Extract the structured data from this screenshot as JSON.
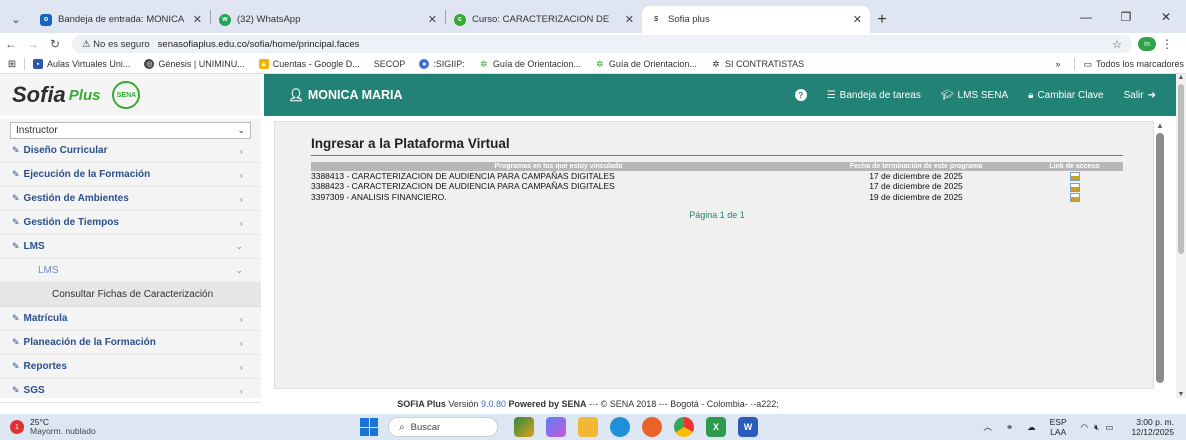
{
  "browser": {
    "tabs": [
      {
        "title": "Bandeja de entrada: MONICA M",
        "icon": "outlook-icon",
        "active": false
      },
      {
        "title": "(32) WhatsApp",
        "icon": "whatsapp-icon",
        "active": false
      },
      {
        "title": "Curso: CARACTERIZACION DE",
        "icon": "moodle-icon",
        "active": false
      },
      {
        "title": "Sofia plus",
        "icon": "sofia-icon",
        "active": true
      }
    ],
    "security_label": "No es seguro",
    "url": "senasofiaplus.edu.co/sofia/home/principal.faces",
    "profile_initial": "m",
    "bookmarks": [
      "Aulas Virtuales Uni...",
      "Génesis | UNIMINU...",
      "Cuentas - Google D...",
      "SECOP",
      ":SIGIIP:",
      "Guía de Orientacion...",
      "Guía de Orientacion...",
      "SI CONTRATISTAS"
    ],
    "bookmarks_overflow": "»",
    "all_bookmarks": "Todos los marcadores"
  },
  "header": {
    "logo_text": "Sofia",
    "logo_plus": "Plus",
    "sena_logo": "SENA",
    "user_name": "MONICA MARIA",
    "links": [
      {
        "label": "Bandeja de tareas",
        "icon": "tray-icon"
      },
      {
        "label": "LMS SENA",
        "icon": "graduation-icon"
      },
      {
        "label": "Cambiar Clave",
        "icon": "lock-icon"
      },
      {
        "label": "Salir",
        "icon": "exit-icon"
      }
    ]
  },
  "sidebar": {
    "role": "Instructor",
    "items": [
      {
        "label": "Diseño Curricular"
      },
      {
        "label": "Ejecución de la Formación"
      },
      {
        "label": "Gestión de Ambientes"
      },
      {
        "label": "Gestión de Tiempos"
      },
      {
        "label": "LMS"
      }
    ],
    "sub_label": "LMS",
    "leaf_label": "Consultar Fichas de Caracterización",
    "items_after": [
      {
        "label": "Matrícula"
      },
      {
        "label": "Planeación de la Formación"
      },
      {
        "label": "Reportes"
      },
      {
        "label": "SGS"
      }
    ]
  },
  "main": {
    "title": "Ingresar a la Plataforma Virtual",
    "columns": [
      "Programas en los que estoy vinculado",
      "Fecha de terminación de este programa",
      "Link de acceso"
    ],
    "rows": [
      {
        "program": "3388413 - CARACTERIZACION DE AUDIENCIA PARA CAMPAÑAS DIGITALES",
        "date": "17 de diciembre de 2025"
      },
      {
        "program": "3388423 - CARACTERIZACION DE AUDIENCIA PARA CAMPAÑAS DIGITALES",
        "date": "17 de diciembre de 2025"
      },
      {
        "program": "3397309 - ANALISIS FINANCIERO.",
        "date": "19 de diciembre de 2025"
      }
    ],
    "pagination": "Página 1 de 1"
  },
  "footer": {
    "prefix": "SOFIA Plus",
    "version_label": "Versión",
    "version": "9.0.80",
    "powered": "Powered by",
    "org": "SENA",
    "rest": "-·- © SENA 2018 -·- Bogotá - Colombia- ·-a222;"
  },
  "taskbar": {
    "temperature": "25°C",
    "condition": "Mayorm. nublado",
    "search_placeholder": "Buscar",
    "lang1": "ESP",
    "lang2": "LAA",
    "time": "3:00 p. m.",
    "date": "12/12/2025"
  }
}
